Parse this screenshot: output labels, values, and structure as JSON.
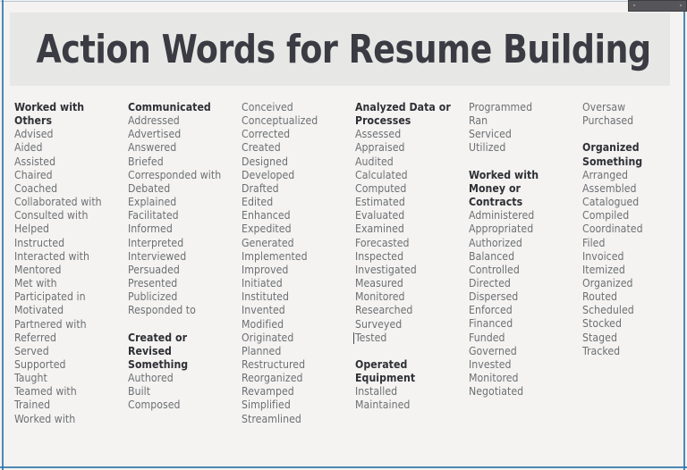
{
  "page": {
    "title": "Action Words for Resume Building",
    "background_color": "#f4f3f2",
    "band_color": "#e7e7e6",
    "frame_color": "#2f74a8",
    "title_color": "#3b3b43",
    "text_color": "#6d6f72",
    "heading_color": "#2f3035",
    "toolbar_chip_color": "#56565a"
  },
  "columns": [
    {
      "name": "column-1",
      "entries": [
        {
          "text": "Worked with",
          "style": "heading"
        },
        {
          "text": "Others",
          "style": "heading"
        },
        {
          "text": "Advised",
          "style": "item"
        },
        {
          "text": "Aided",
          "style": "item"
        },
        {
          "text": "Assisted",
          "style": "item"
        },
        {
          "text": "Chaired",
          "style": "item"
        },
        {
          "text": "Coached",
          "style": "item"
        },
        {
          "text": "Collaborated with",
          "style": "item"
        },
        {
          "text": "Consulted with",
          "style": "item"
        },
        {
          "text": "Helped",
          "style": "item"
        },
        {
          "text": "Instructed",
          "style": "item"
        },
        {
          "text": "Interacted with",
          "style": "item"
        },
        {
          "text": "Mentored",
          "style": "item"
        },
        {
          "text": "Met with",
          "style": "item"
        },
        {
          "text": "Participated in",
          "style": "item"
        },
        {
          "text": "Motivated",
          "style": "item"
        },
        {
          "text": "Partnered with",
          "style": "item"
        },
        {
          "text": "Referred",
          "style": "item"
        },
        {
          "text": "Served",
          "style": "item"
        },
        {
          "text": "Supported",
          "style": "item"
        },
        {
          "text": "Taught",
          "style": "item"
        },
        {
          "text": "Teamed with",
          "style": "item"
        },
        {
          "text": "Trained",
          "style": "item"
        },
        {
          "text": "Worked with",
          "style": "item"
        }
      ]
    },
    {
      "name": "column-2",
      "entries": [
        {
          "text": "Communicated",
          "style": "heading"
        },
        {
          "text": "Addressed",
          "style": "item"
        },
        {
          "text": "Advertised",
          "style": "item"
        },
        {
          "text": "Answered",
          "style": "item"
        },
        {
          "text": "Briefed",
          "style": "item"
        },
        {
          "text": "Corresponded with",
          "style": "item"
        },
        {
          "text": "Debated",
          "style": "item"
        },
        {
          "text": "Explained",
          "style": "item"
        },
        {
          "text": "Facilitated",
          "style": "item"
        },
        {
          "text": "Informed",
          "style": "item"
        },
        {
          "text": "Interpreted",
          "style": "item"
        },
        {
          "text": "Interviewed",
          "style": "item"
        },
        {
          "text": "Persuaded",
          "style": "item"
        },
        {
          "text": "Presented",
          "style": "item"
        },
        {
          "text": "Publicized",
          "style": "item"
        },
        {
          "text": "Responded to",
          "style": "item"
        },
        {
          "text": "",
          "style": "spacer"
        },
        {
          "text": "Created or",
          "style": "heading"
        },
        {
          "text": "Revised",
          "style": "heading"
        },
        {
          "text": "Something",
          "style": "heading"
        },
        {
          "text": "Authored",
          "style": "item"
        },
        {
          "text": "Built",
          "style": "item"
        },
        {
          "text": "Composed",
          "style": "item"
        }
      ]
    },
    {
      "name": "column-3",
      "entries": [
        {
          "text": "Conceived",
          "style": "item"
        },
        {
          "text": "Conceptualized",
          "style": "item"
        },
        {
          "text": "Corrected",
          "style": "item"
        },
        {
          "text": "Created",
          "style": "item"
        },
        {
          "text": "Designed",
          "style": "item"
        },
        {
          "text": "Developed",
          "style": "item"
        },
        {
          "text": "Drafted",
          "style": "item"
        },
        {
          "text": "Edited",
          "style": "item"
        },
        {
          "text": "Enhanced",
          "style": "item"
        },
        {
          "text": "Expedited",
          "style": "item"
        },
        {
          "text": "Generated",
          "style": "item"
        },
        {
          "text": "Implemented",
          "style": "item"
        },
        {
          "text": "Improved",
          "style": "item"
        },
        {
          "text": "Initiated",
          "style": "item"
        },
        {
          "text": "Instituted",
          "style": "item"
        },
        {
          "text": "Invented",
          "style": "item"
        },
        {
          "text": "Modified",
          "style": "item"
        },
        {
          "text": "Originated",
          "style": "item"
        },
        {
          "text": "Planned",
          "style": "item"
        },
        {
          "text": "Restructured",
          "style": "item"
        },
        {
          "text": "Reorganized",
          "style": "item"
        },
        {
          "text": "Revamped",
          "style": "item"
        },
        {
          "text": "Simplified",
          "style": "item"
        },
        {
          "text": "Streamlined",
          "style": "item"
        }
      ]
    },
    {
      "name": "column-4",
      "entries": [
        {
          "text": "Analyzed Data or",
          "style": "heading"
        },
        {
          "text": "Processes",
          "style": "heading"
        },
        {
          "text": "Assessed",
          "style": "item"
        },
        {
          "text": "Appraised",
          "style": "item"
        },
        {
          "text": "Audited",
          "style": "item"
        },
        {
          "text": "Calculated",
          "style": "item"
        },
        {
          "text": "Computed",
          "style": "item"
        },
        {
          "text": "Estimated",
          "style": "item"
        },
        {
          "text": "Evaluated",
          "style": "item"
        },
        {
          "text": "Examined",
          "style": "item"
        },
        {
          "text": "Forecasted",
          "style": "item"
        },
        {
          "text": "Inspected",
          "style": "item"
        },
        {
          "text": "Investigated",
          "style": "item"
        },
        {
          "text": "Measured",
          "style": "item"
        },
        {
          "text": "Monitored",
          "style": "item"
        },
        {
          "text": "Researched",
          "style": "item"
        },
        {
          "text": "Surveyed",
          "style": "item"
        },
        {
          "text": "Tested",
          "style": "caret"
        },
        {
          "text": "",
          "style": "spacer"
        },
        {
          "text": "Operated",
          "style": "heading"
        },
        {
          "text": "Equipment",
          "style": "heading"
        },
        {
          "text": "Installed",
          "style": "item"
        },
        {
          "text": "Maintained",
          "style": "item"
        }
      ]
    },
    {
      "name": "column-5",
      "entries": [
        {
          "text": "Programmed",
          "style": "item"
        },
        {
          "text": "Ran",
          "style": "item"
        },
        {
          "text": "Serviced",
          "style": "item"
        },
        {
          "text": "Utilized",
          "style": "item"
        },
        {
          "text": "",
          "style": "spacer"
        },
        {
          "text": "Worked with",
          "style": "heading"
        },
        {
          "text": "Money or",
          "style": "heading"
        },
        {
          "text": "Contracts",
          "style": "heading"
        },
        {
          "text": "Administered",
          "style": "item"
        },
        {
          "text": "Appropriated",
          "style": "item"
        },
        {
          "text": "Authorized",
          "style": "item"
        },
        {
          "text": "Balanced",
          "style": "item"
        },
        {
          "text": "Controlled",
          "style": "item"
        },
        {
          "text": "Directed",
          "style": "item"
        },
        {
          "text": "Dispersed",
          "style": "item"
        },
        {
          "text": "Enforced",
          "style": "item"
        },
        {
          "text": "Financed",
          "style": "item"
        },
        {
          "text": "Funded",
          "style": "item"
        },
        {
          "text": "Governed",
          "style": "item"
        },
        {
          "text": "Invested",
          "style": "item"
        },
        {
          "text": "Monitored",
          "style": "item"
        },
        {
          "text": "Negotiated",
          "style": "item"
        }
      ]
    },
    {
      "name": "column-6",
      "entries": [
        {
          "text": "Oversaw",
          "style": "item"
        },
        {
          "text": "Purchased",
          "style": "item"
        },
        {
          "text": "",
          "style": "spacer"
        },
        {
          "text": "Organized",
          "style": "heading"
        },
        {
          "text": "Something",
          "style": "heading"
        },
        {
          "text": "Arranged",
          "style": "item"
        },
        {
          "text": "Assembled",
          "style": "item"
        },
        {
          "text": "Catalogued",
          "style": "item"
        },
        {
          "text": "Compiled",
          "style": "item"
        },
        {
          "text": "Coordinated",
          "style": "item"
        },
        {
          "text": "Filed",
          "style": "item"
        },
        {
          "text": "Invoiced",
          "style": "item"
        },
        {
          "text": "Itemized",
          "style": "item"
        },
        {
          "text": "Organized",
          "style": "item"
        },
        {
          "text": "Routed",
          "style": "item"
        },
        {
          "text": "Scheduled",
          "style": "item"
        },
        {
          "text": "Stocked",
          "style": "item"
        },
        {
          "text": "Staged",
          "style": "item"
        },
        {
          "text": "Tracked",
          "style": "item"
        }
      ]
    }
  ]
}
